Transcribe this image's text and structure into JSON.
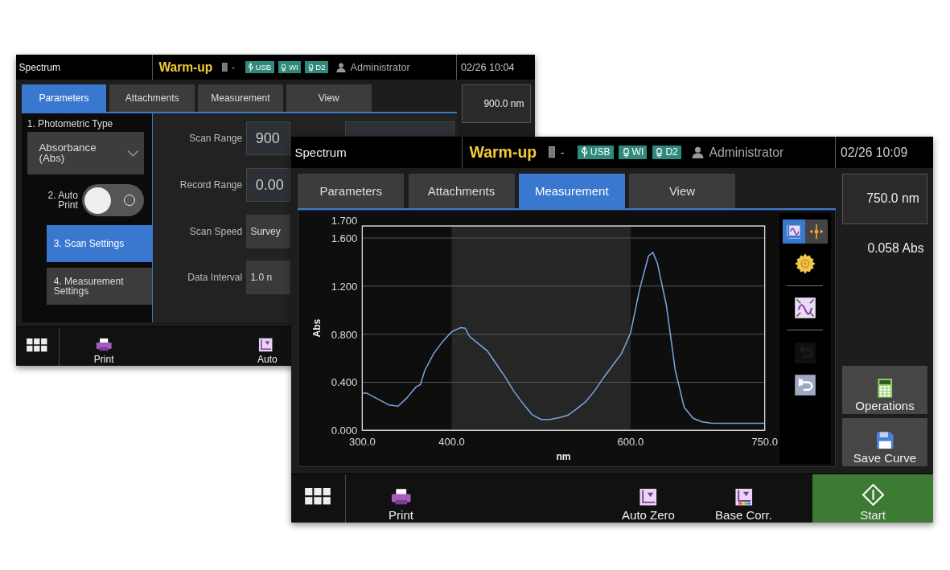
{
  "windows": [
    {
      "kind": "settings",
      "title": "Spectrum",
      "status": "Warm-up",
      "lamp_status": "-",
      "indicators": [
        {
          "kind": "usb",
          "label": "USB"
        },
        {
          "kind": "lamp",
          "label": "WI"
        },
        {
          "kind": "lamp",
          "label": "D2"
        }
      ],
      "user": "Administrator",
      "datetime": "02/26 10:04",
      "tabs": [
        {
          "label": "Parameters",
          "selected": true
        },
        {
          "label": "Attachments",
          "selected": false
        },
        {
          "label": "Measurement",
          "selected": false
        },
        {
          "label": "View",
          "selected": false
        }
      ],
      "wavelength": "900.0 nm",
      "quick_settings": [
        {
          "kind": "dropdown",
          "label": "1. Photometric Type",
          "value": "Absorbance\n(Abs)"
        },
        {
          "kind": "toggle",
          "label": "2. Auto\nPrint",
          "on": false
        }
      ],
      "setting_pages": [
        {
          "label": "3. Scan Settings",
          "selected": true
        },
        {
          "label": "4. Measurement\nSettings",
          "selected": false
        }
      ],
      "fields": [
        {
          "kind": "range",
          "label": "Scan Range",
          "value": "900"
        },
        {
          "kind": "number",
          "label": "Record Range",
          "value": "0.00"
        },
        {
          "kind": "select",
          "label": "Scan Speed",
          "value": "Survey"
        },
        {
          "kind": "select",
          "label": "Data Interval",
          "value": "1.0 n"
        }
      ],
      "footer_buttons": [
        {
          "kind": "apps"
        },
        {
          "kind": "print",
          "label": "Print"
        },
        {
          "kind": "auto_zero",
          "label": "Auto"
        }
      ]
    },
    {
      "kind": "measurement",
      "title": "Spectrum",
      "status": "Warm-up",
      "lamp_status": "-",
      "indicators": [
        {
          "kind": "usb",
          "label": "USB"
        },
        {
          "kind": "lamp",
          "label": "WI"
        },
        {
          "kind": "lamp",
          "label": "D2"
        }
      ],
      "user": "Administrator",
      "datetime": "02/26 10:09",
      "tabs": [
        {
          "label": "Parameters",
          "selected": false
        },
        {
          "label": "Attachments",
          "selected": false
        },
        {
          "label": "Measurement",
          "selected": true
        },
        {
          "label": "View",
          "selected": false
        }
      ],
      "wavelength": "750.0 nm",
      "reading": "0.058 Abs",
      "chart_data": {
        "type": "line",
        "xlabel": "nm",
        "ylabel": "Abs",
        "xlim": [
          300,
          750
        ],
        "ylim": [
          0,
          1.7
        ],
        "xticks": [
          {
            "value": 300,
            "label": "300.0"
          },
          {
            "value": 400,
            "label": "400.0"
          },
          {
            "value": 600,
            "label": "600.0"
          },
          {
            "value": 750,
            "label": "750.0"
          }
        ],
        "yticks": [
          {
            "value": 0,
            "label": "0.000"
          },
          {
            "value": 0.4,
            "label": "0.400"
          },
          {
            "value": 0.8,
            "label": "0.800"
          },
          {
            "value": 1.2,
            "label": "1.200"
          },
          {
            "value": 1.6,
            "label": "1.600"
          },
          {
            "value": 1.7,
            "label": "1.700"
          }
        ],
        "x": [
          300,
          305,
          320,
          330,
          340,
          350,
          360,
          365,
          370,
          380,
          390,
          400,
          410,
          415,
          420,
          430,
          440,
          450,
          460,
          470,
          480,
          490,
          500,
          510,
          520,
          530,
          540,
          550,
          560,
          570,
          580,
          590,
          600,
          610,
          620,
          625,
          630,
          640,
          650,
          660,
          670,
          680,
          690,
          700,
          750
        ],
        "series": [
          {
            "color": "#7aa6e0",
            "values": [
              0.31,
              0.31,
              0.25,
              0.21,
              0.2,
              0.27,
              0.36,
              0.38,
              0.5,
              0.64,
              0.74,
              0.82,
              0.855,
              0.85,
              0.78,
              0.72,
              0.66,
              0.55,
              0.44,
              0.32,
              0.22,
              0.13,
              0.09,
              0.09,
              0.105,
              0.125,
              0.18,
              0.24,
              0.33,
              0.44,
              0.54,
              0.64,
              0.81,
              1.17,
              1.45,
              1.48,
              1.39,
              1.04,
              0.5,
              0.19,
              0.1,
              0.07,
              0.06,
              0.058,
              0.058
            ]
          }
        ],
        "grid": true
      },
      "view_modes": [
        {
          "kind": "axis",
          "selected": true
        },
        {
          "kind": "cursor",
          "selected": false
        }
      ],
      "tools": [
        {
          "kind": "settings",
          "disabled": false
        },
        {
          "kind": "fit",
          "disabled": false
        },
        {
          "kind": "undo",
          "disabled": true
        },
        {
          "kind": "reset",
          "disabled": false
        }
      ],
      "side_buttons": [
        {
          "kind": "operations",
          "label": "Operations"
        },
        {
          "kind": "save",
          "label": "Save Curve"
        }
      ],
      "footer_buttons": [
        {
          "kind": "apps"
        },
        {
          "kind": "print",
          "label": "Print"
        },
        {
          "kind": "auto_zero",
          "label": "Auto Zero"
        },
        {
          "kind": "base_corr",
          "label": "Base Corr."
        },
        {
          "kind": "start",
          "label": "Start"
        }
      ]
    }
  ]
}
